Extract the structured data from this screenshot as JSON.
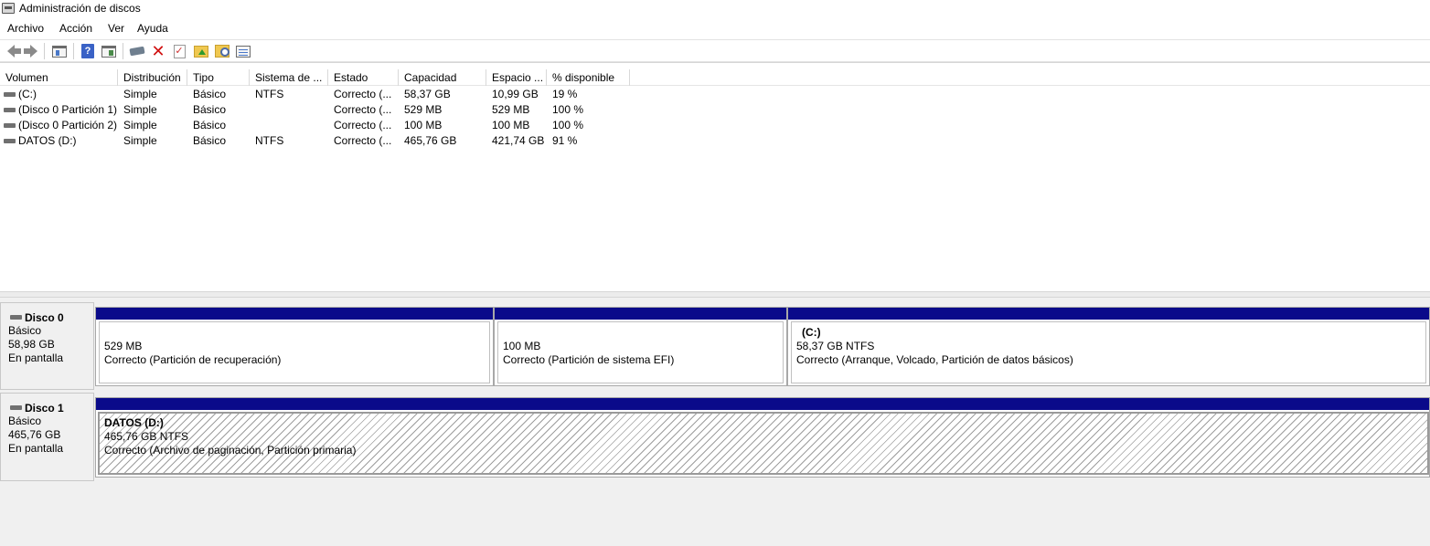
{
  "window": {
    "title": "Administración de discos"
  },
  "menu": [
    "Archivo",
    "Acción",
    "Ver",
    "Ayuda"
  ],
  "toolbar": {
    "buttons": [
      "back-icon",
      "forward-icon",
      "console-pane-icon",
      "help-icon",
      "action-pane-icon",
      "connect-disk-icon",
      "delete-icon",
      "check-icon",
      "folder-up-icon",
      "find-icon",
      "properties-icon"
    ]
  },
  "volume_table": {
    "columns": [
      "Volumen",
      "Distribución",
      "Tipo",
      "Sistema de ...",
      "Estado",
      "Capacidad",
      "Espacio ...",
      "% disponible"
    ],
    "rows": [
      {
        "volumen": " (C:)",
        "distribucion": "Simple",
        "tipo": "Básico",
        "sistema": "NTFS",
        "estado": "Correcto (...",
        "capacidad": "58,37 GB",
        "espacio": "10,99 GB",
        "disponible": "19 %"
      },
      {
        "volumen": "(Disco 0 Partición 1)",
        "distribucion": "Simple",
        "tipo": "Básico",
        "sistema": "",
        "estado": "Correcto (...",
        "capacidad": "529 MB",
        "espacio": "529 MB",
        "disponible": "100 %"
      },
      {
        "volumen": "(Disco 0 Partición 2)",
        "distribucion": "Simple",
        "tipo": "Básico",
        "sistema": "",
        "estado": "Correcto (...",
        "capacidad": "100 MB",
        "espacio": "100 MB",
        "disponible": "100 %"
      },
      {
        "volumen": "DATOS (D:)",
        "distribucion": "Simple",
        "tipo": "Básico",
        "sistema": "NTFS",
        "estado": "Correcto (...",
        "capacidad": "465,76 GB",
        "espacio": "421,74 GB",
        "disponible": "91 %"
      }
    ]
  },
  "disks": [
    {
      "name": "Disco 0",
      "type": "Básico",
      "size": "58,98 GB",
      "status": "En pantalla",
      "partitions": [
        {
          "title": "",
          "size": "529 MB",
          "status": "Correcto (Partición de recuperación)"
        },
        {
          "title": "",
          "size": "100 MB",
          "status": "Correcto (Partición de sistema EFI)"
        },
        {
          "title": "(C:)",
          "size": "58,37 GB NTFS",
          "status": "Correcto (Arranque, Volcado, Partición de datos básicos)"
        }
      ]
    },
    {
      "name": "Disco 1",
      "type": "Básico",
      "size": "465,76 GB",
      "status": "En pantalla",
      "partitions": [
        {
          "title": "DATOS  (D:)",
          "size": "465,76 GB NTFS",
          "status": "Correcto (Archivo de paginación, Partición primaria)"
        }
      ]
    }
  ],
  "colors": {
    "partition_bar": "#0a0a8a",
    "background": "#f0f0f0"
  }
}
